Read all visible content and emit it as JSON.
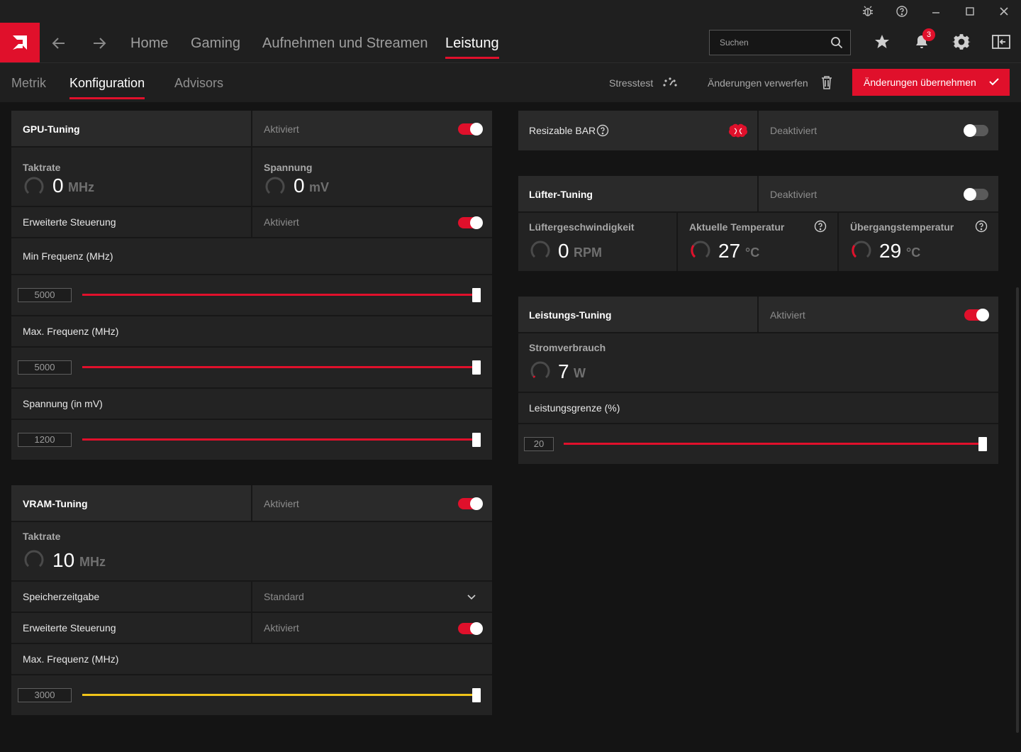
{
  "titlebar": {
    "icons": [
      "bug-icon",
      "help-icon",
      "minimize-icon",
      "maximize-icon",
      "close-icon"
    ]
  },
  "nav": {
    "items": [
      {
        "label": "Home"
      },
      {
        "label": "Gaming"
      },
      {
        "label": "Aufnehmen und Streamen"
      },
      {
        "label": "Leistung",
        "active": true
      }
    ],
    "search_placeholder": "Suchen",
    "notifications_count": "3"
  },
  "subnav": {
    "tabs": [
      {
        "label": "Metrik"
      },
      {
        "label": "Konfiguration",
        "active": true
      },
      {
        "label": "Advisors"
      }
    ],
    "stresstest": "Stresstest",
    "discard": "Änderungen verwerfen",
    "apply": "Änderungen übernehmen"
  },
  "accent_color": "#e0102b",
  "vram_slider_color": "#f0c419",
  "gpu_tuning": {
    "title": "GPU-Tuning",
    "state": "Aktiviert",
    "enabled": true,
    "clock": {
      "title": "Taktrate",
      "value": "0",
      "unit": "MHz"
    },
    "voltage": {
      "title": "Spannung",
      "value": "0",
      "unit": "mV"
    },
    "advanced": {
      "label": "Erweiterte Steuerung",
      "state": "Aktiviert",
      "enabled": true
    },
    "min_freq": {
      "label": "Min Frequenz (MHz)",
      "value": "5000",
      "fill": 1.0
    },
    "max_freq": {
      "label": "Max. Frequenz (MHz)",
      "value": "5000",
      "fill": 1.0
    },
    "voltage_slider": {
      "label": "Spannung (in mV)",
      "value": "1200",
      "fill": 1.0
    }
  },
  "vram_tuning": {
    "title": "VRAM-Tuning",
    "state": "Aktiviert",
    "enabled": true,
    "clock": {
      "title": "Taktrate",
      "value": "10",
      "unit": "MHz"
    },
    "timing": {
      "label": "Speicherzeitgabe",
      "value": "Standard"
    },
    "advanced": {
      "label": "Erweiterte Steuerung",
      "state": "Aktiviert",
      "enabled": true
    },
    "max_freq": {
      "label": "Max. Frequenz (MHz)",
      "value": "3000",
      "fill": 1.0
    }
  },
  "resizable_bar": {
    "label": "Resizable BAR",
    "state": "Deaktiviert",
    "enabled": false
  },
  "fan_tuning": {
    "title": "Lüfter-Tuning",
    "state": "Deaktiviert",
    "enabled": false,
    "speed": {
      "title": "Lüftergeschwindigkeit",
      "value": "0",
      "unit": "RPM"
    },
    "current_temp": {
      "title": "Aktuelle Temperatur",
      "value": "27",
      "unit": "°C"
    },
    "junction_temp": {
      "title": "Übergangstemperatur",
      "value": "29",
      "unit": "°C"
    }
  },
  "power_tuning": {
    "title": "Leistungs-Tuning",
    "state": "Aktiviert",
    "enabled": true,
    "power": {
      "title": "Stromverbrauch",
      "value": "7",
      "unit": "W"
    },
    "limit": {
      "label": "Leistungsgrenze (%)",
      "value": "20",
      "fill": 1.0
    }
  }
}
